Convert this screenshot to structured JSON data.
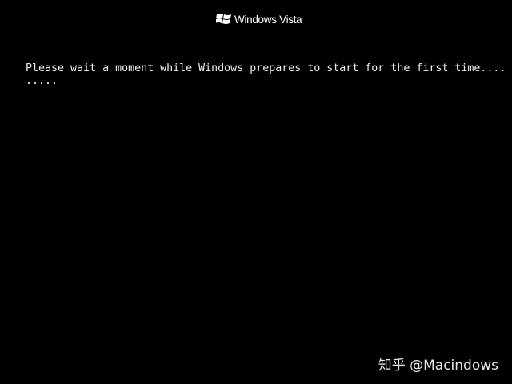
{
  "logo": {
    "text": "Windows Vista",
    "icon": "windows-flag-icon"
  },
  "boot": {
    "message": "Please wait a moment while Windows prepares to start for the first time....",
    "progress_dots": "....."
  },
  "watermark": {
    "text": "知乎 @Macindows"
  }
}
